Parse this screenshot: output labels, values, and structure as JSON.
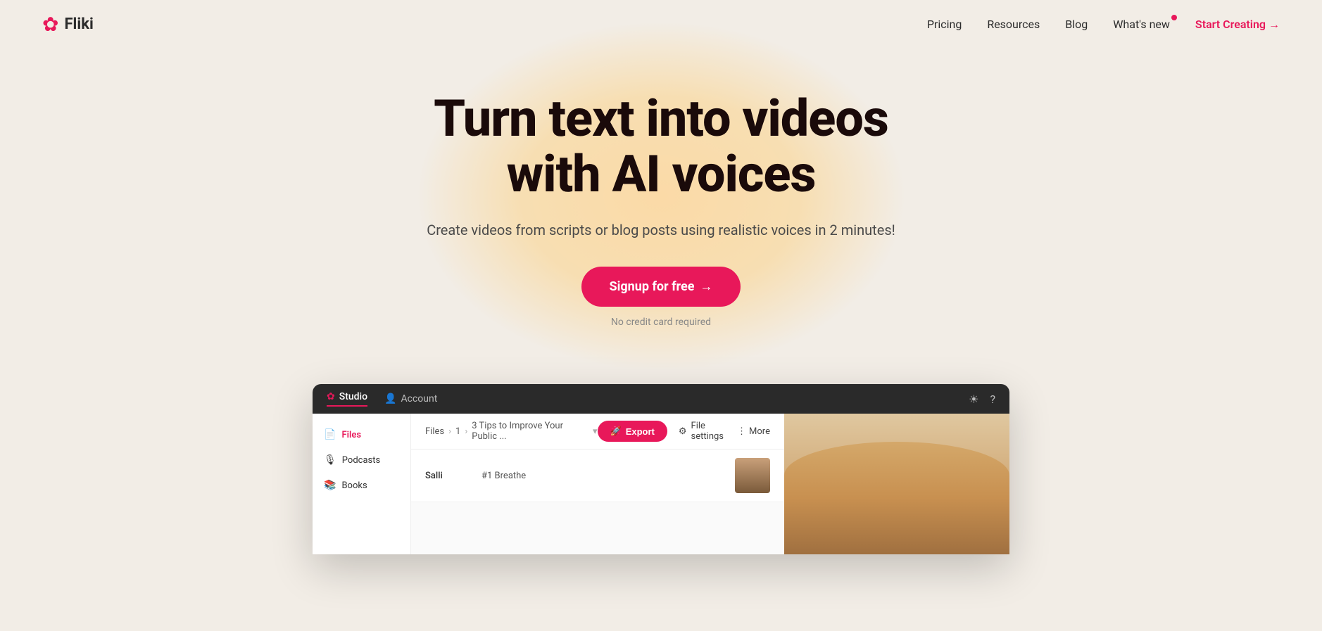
{
  "header": {
    "logo_text": "Fliki",
    "nav": {
      "pricing": "Pricing",
      "resources": "Resources",
      "blog": "Blog",
      "whats_new": "What's new",
      "start_creating": "Start Creating",
      "start_creating_arrow": "→"
    }
  },
  "hero": {
    "title_line1": "Turn text into videos",
    "title_line2": "with AI voices",
    "subtitle": "Create videos from scripts or blog posts using realistic voices in 2 minutes!",
    "cta_button": "Signup for free",
    "cta_arrow": "→",
    "no_credit": "No credit card required"
  },
  "app_preview": {
    "titlebar": {
      "studio_tab": "Studio",
      "account_tab": "Account"
    },
    "sidebar": {
      "items": [
        {
          "label": "Files",
          "active": true
        },
        {
          "label": "Podcasts",
          "active": false
        },
        {
          "label": "Books",
          "active": false
        }
      ]
    },
    "toolbar": {
      "breadcrumb": [
        "Files",
        "1",
        "3 Tips to Improve Your Public ..."
      ],
      "export_btn": "Export",
      "file_settings": "File settings",
      "more": "More"
    },
    "table": {
      "row": {
        "name": "Salli",
        "title": "#1 Breathe"
      }
    }
  }
}
